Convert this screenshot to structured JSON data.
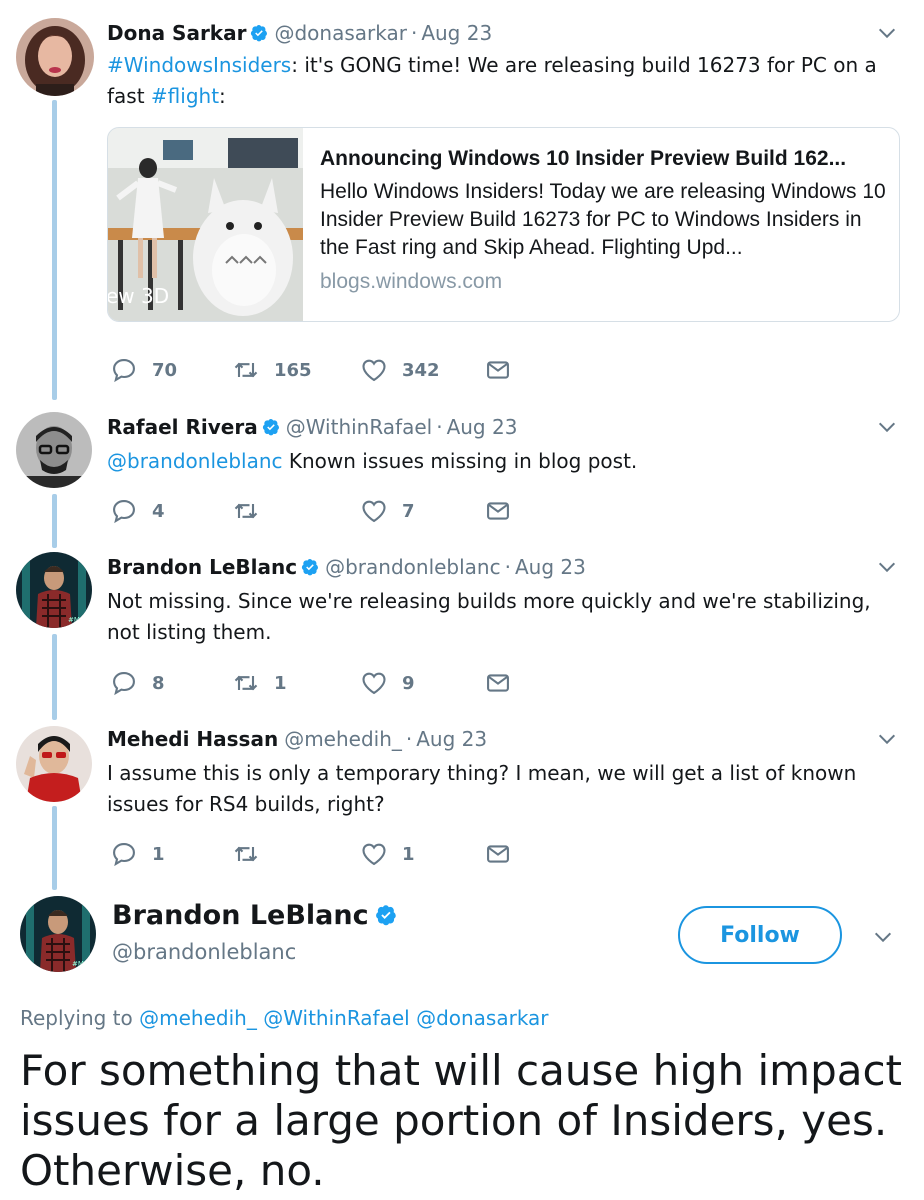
{
  "tweets": [
    {
      "name": "Dona Sarkar",
      "handle": "@donasarkar",
      "date": "Aug 23",
      "text_hashtag1": "#WindowsInsiders",
      "text_middle": ": it's GONG time! We are releasing build 16273 for PC on a fast ",
      "text_hashtag2": "#flight",
      "text_end": ":",
      "card": {
        "title": "Announcing Windows 10 Insider Preview Build 162...",
        "description": "Hello Windows Insiders! Today we are releasing Windows 10 Insider Preview Build 16273 for PC to Windows Insiders in the Fast ring and Skip Ahead. Flighting Upd...",
        "domain": "blogs.windows.com",
        "image_overlay_text": "ew 3D"
      },
      "replies": "70",
      "retweets": "165",
      "likes": "342"
    },
    {
      "name": "Rafael Rivera",
      "handle": "@WithinRafael",
      "date": "Aug 23",
      "mention": "@brandonleblanc",
      "text": " Known issues missing in blog post.",
      "replies": "4",
      "retweets": "",
      "likes": "7"
    },
    {
      "name": "Brandon LeBlanc",
      "handle": "@brandonleblanc",
      "date": "Aug 23",
      "text": "Not missing. Since we're releasing builds more quickly and we're stabilizing, not listing them.",
      "replies": "8",
      "retweets": "1",
      "likes": "9"
    },
    {
      "name": "Mehedi Hassan",
      "handle": "@mehedih_",
      "date": "Aug 23",
      "text": "I assume this is only a temporary thing? I mean, we will get a list of known issues for RS4 builds, right?",
      "replies": "1",
      "retweets": "",
      "likes": "1"
    }
  ],
  "separator": "·",
  "focus": {
    "name": "Brandon LeBlanc",
    "handle": "@brandonleblanc",
    "follow_label": "Follow",
    "replying_prefix": "Replying to",
    "replying_to": [
      "@mehedih_",
      "@WithinRafael",
      "@donasarkar"
    ],
    "text": "For something that will cause high impact issues for a large portion of Insiders, yes. Otherwise, no."
  },
  "colors": {
    "link": "#1b95e0",
    "verified": "#1da1f2",
    "muted": "#657786",
    "thread_line": "#a8cde8"
  },
  "icons": [
    "reply-icon",
    "retweet-icon",
    "like-icon",
    "dm-icon",
    "verified-badge-icon",
    "chevron-down-icon"
  ]
}
